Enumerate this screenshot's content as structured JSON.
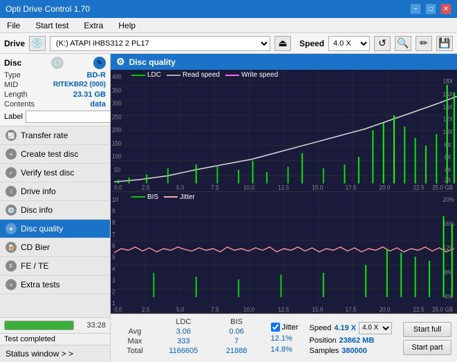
{
  "titlebar": {
    "title": "Opti Drive Control 1.70",
    "btn_minimize": "−",
    "btn_maximize": "□",
    "btn_close": "✕"
  },
  "menubar": {
    "items": [
      "File",
      "Start test",
      "Extra",
      "Help"
    ]
  },
  "drivebar": {
    "label": "Drive",
    "drive_value": "(K:) ATAPI iHBS312  2 PL17",
    "speed_label": "Speed",
    "speed_value": "4.0 X"
  },
  "disc": {
    "header": "Disc",
    "type_label": "Type",
    "type_value": "BD-R",
    "mid_label": "MID",
    "mid_value": "RITEKBR2 (000)",
    "length_label": "Length",
    "length_value": "23.31 GB",
    "contents_label": "Contents",
    "contents_value": "data",
    "label_label": "Label",
    "label_value": ""
  },
  "nav": {
    "items": [
      {
        "id": "transfer-rate",
        "label": "Transfer rate"
      },
      {
        "id": "create-test-disc",
        "label": "Create test disc"
      },
      {
        "id": "verify-test-disc",
        "label": "Verify test disc"
      },
      {
        "id": "drive-info",
        "label": "Drive info"
      },
      {
        "id": "disc-info",
        "label": "Disc info"
      },
      {
        "id": "disc-quality",
        "label": "Disc quality",
        "active": true
      },
      {
        "id": "cd-bier",
        "label": "CD Bier"
      },
      {
        "id": "fe-te",
        "label": "FE / TE"
      },
      {
        "id": "extra-tests",
        "label": "Extra tests"
      }
    ]
  },
  "status_window": {
    "label": "Status window > >"
  },
  "progress": {
    "percent": "100.0%",
    "value": 100,
    "status_text": "Test completed",
    "time": "33:28"
  },
  "disc_quality": {
    "title": "Disc quality"
  },
  "upper_chart": {
    "legend": [
      {
        "label": "LDC",
        "color": "#00cc00"
      },
      {
        "label": "Read speed",
        "color": "#aaaaaa"
      },
      {
        "label": "Write speed",
        "color": "#ff66ff"
      }
    ],
    "y_right": [
      "18X",
      "16X",
      "14X",
      "12X",
      "10X",
      "8X",
      "6X",
      "4X",
      "2X"
    ],
    "y_left": [
      "400",
      "350",
      "300",
      "250",
      "200",
      "150",
      "100",
      "50"
    ],
    "x_labels": [
      "0.0",
      "2.5",
      "5.0",
      "7.5",
      "10.0",
      "12.5",
      "15.0",
      "17.5",
      "20.0",
      "22.5",
      "25.0 GB"
    ]
  },
  "lower_chart": {
    "legend": [
      {
        "label": "BIS",
        "color": "#00cc00"
      },
      {
        "label": "Jitter",
        "color": "#ffaaaa"
      }
    ],
    "y_right": [
      "20%",
      "16%",
      "12%",
      "8%",
      "4%"
    ],
    "y_left": [
      "10",
      "9",
      "8",
      "7",
      "6",
      "5",
      "4",
      "3",
      "2",
      "1"
    ],
    "x_labels": [
      "0.0",
      "2.5",
      "5.0",
      "7.5",
      "10.0",
      "12.5",
      "15.0",
      "17.5",
      "20.0",
      "22.5",
      "25.0 GB"
    ]
  },
  "stats": {
    "columns": [
      "LDC",
      "BIS"
    ],
    "jitter_label": "Jitter",
    "jitter_checked": true,
    "rows": [
      {
        "label": "Avg",
        "ldc": "3.06",
        "bis": "0.06",
        "jitter": "12.1%"
      },
      {
        "label": "Max",
        "ldc": "333",
        "bis": "7",
        "jitter": "14.8%"
      },
      {
        "label": "Total",
        "ldc": "1166605",
        "bis": "21888",
        "jitter": ""
      }
    ],
    "speed_label": "Speed",
    "speed_value": "4.19 X",
    "speed_select": "4.0 X",
    "position_label": "Position",
    "position_value": "23862 MB",
    "samples_label": "Samples",
    "samples_value": "380000",
    "btn_start_full": "Start full",
    "btn_start_part": "Start part"
  }
}
